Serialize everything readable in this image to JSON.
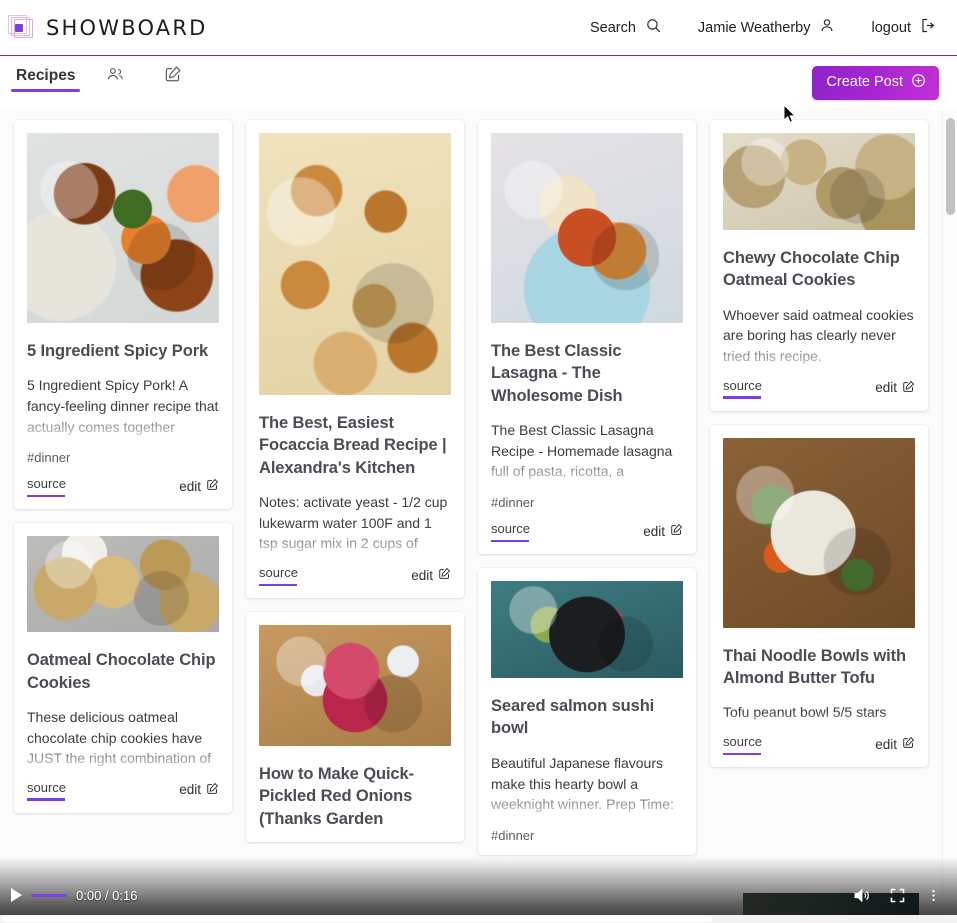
{
  "header": {
    "brand": "SHOWBOARD",
    "logo_icon": "nested-squares-logo",
    "search_label": "Search",
    "search_icon": "search-icon",
    "user_name": "Jamie Weatherby",
    "user_icon": "person-icon",
    "logout_label": "logout",
    "logout_icon": "logout-arrow-icon",
    "accent_color": "#7b3fe4",
    "border_color": "#6f2da8"
  },
  "tabbar": {
    "active_tab": "Recipes",
    "people_icon": "people-icon",
    "compose_icon": "compose-edit-icon",
    "create_post_label": "Create Post",
    "create_post_icon": "plus-circle-icon",
    "create_post_color": "#a524d3"
  },
  "common": {
    "source_label": "source",
    "edit_label": "edit",
    "edit_icon": "pencil-square-icon"
  },
  "columns": [
    {
      "cards": [
        {
          "image": "img-pork",
          "image_alt": "spicy pork rice bowl",
          "title": "5 Ingredient Spicy Pork",
          "description": "5 Ingredient Spicy Pork! A fancy-feeling dinner recipe that actually comes together",
          "tag": "#dinner"
        },
        {
          "image": "img-cookies2",
          "image_alt": "oatmeal chocolate chip cookies on tray",
          "title": "Oatmeal Chocolate Chip Cookies",
          "description": "These delicious oatmeal chocolate chip cookies have JUST the right combination of",
          "tag": ""
        }
      ]
    },
    {
      "cards": [
        {
          "image": "img-focaccia",
          "image_alt": "rosemary focaccia bread in pan",
          "title": "The Best, Easiest Focaccia Bread Recipe | Alexandra's Kitchen",
          "description": "Notes: activate yeast - 1/2 cup lukewarm water 100F and 1 tsp sugar mix in 2 cups of",
          "tag": ""
        },
        {
          "image": "img-onions",
          "image_alt": "jar of quick pickled red onions",
          "title": "How to Make Quick-Pickled Red Onions (Thanks Garden",
          "description": "",
          "tag": ""
        }
      ]
    },
    {
      "cards": [
        {
          "image": "img-lasagna",
          "image_alt": "slice of classic lasagna on blue plate",
          "title": "The Best Classic Lasagna - The Wholesome Dish",
          "description": "The Best Classic Lasagna Recipe - Homemade lasagna full of pasta, ricotta, a",
          "tag": "#dinner"
        },
        {
          "image": "img-sushi",
          "image_alt": "seared salmon sushi bowl",
          "title": "Seared salmon sushi bowl",
          "description": "Beautiful Japanese flavours make this hearty bowl a weeknight winner. Prep Time:",
          "tag": "#dinner"
        }
      ]
    },
    {
      "cards": [
        {
          "image": "img-cookies1",
          "image_alt": "chewy chocolate chip oatmeal cookies",
          "title": "Chewy Chocolate Chip Oatmeal Cookies",
          "description": "Whoever said oatmeal cookies are boring has clearly never tried this recipe.",
          "tag": ""
        },
        {
          "image": "img-thai",
          "image_alt": "thai noodle bowl with tofu",
          "title": "Thai Noodle Bowls with Almond Butter Tofu",
          "description": "Tofu peanut bowl 5/5 stars",
          "tag": ""
        }
      ]
    }
  ],
  "video_player": {
    "play_icon": "play-icon",
    "current_time": "0:00",
    "duration": "0:16",
    "time_display": "0:00 / 0:16",
    "volume_icon": "volume-icon",
    "fullscreen_icon": "fullscreen-icon",
    "more_icon": "more-vertical-icon",
    "progress_percent": 0
  }
}
